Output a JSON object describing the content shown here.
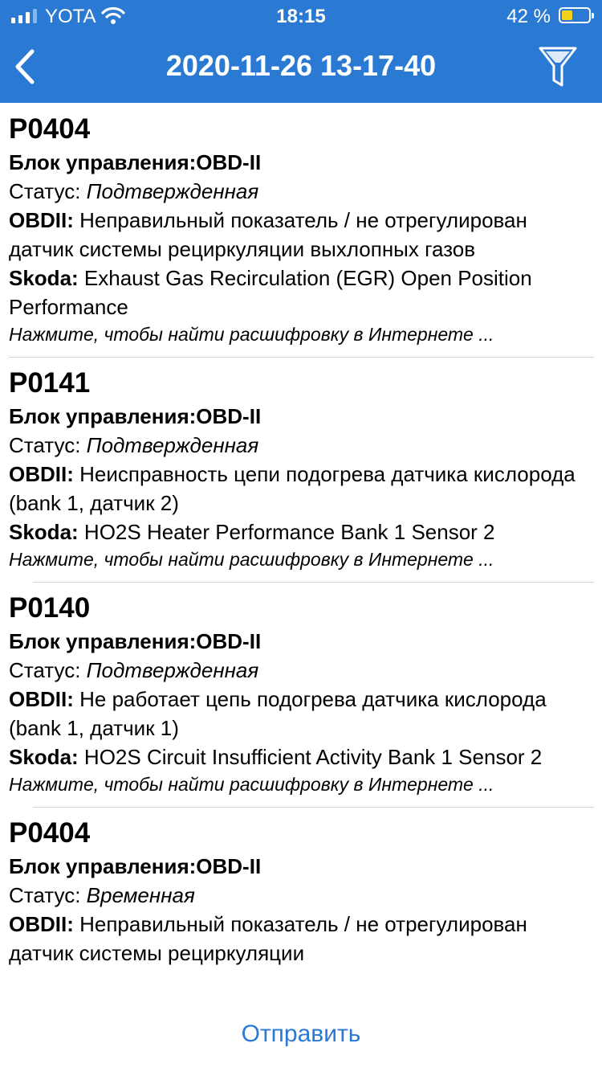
{
  "status_bar": {
    "carrier": "YOTA",
    "time": "18:15",
    "battery_percent": "42 %",
    "battery_level": 0.42,
    "battery_color": "#f6d11b"
  },
  "nav": {
    "title": "2020-11-26 13-17-40",
    "back_icon": "chevron-left-icon",
    "filter_icon": "filter-icon",
    "background_color": "#2a7ad3"
  },
  "records": [
    {
      "code": "P0404",
      "unit_label": "Блок управления:",
      "unit_value": "OBD-II",
      "status_label": "Статус: ",
      "status_value": "Подтвержденная",
      "obd_label": "OBDII: ",
      "obd_text": "Неправильный показатель / не отрегулирован датчик системы рециркуляции выхлопных газов",
      "make_label": "Skoda: ",
      "make_text": "Exhaust Gas Recirculation (EGR) Open Position Performance",
      "hint": "Нажмите, чтобы найти расшифровку в Интернете ..."
    },
    {
      "code": "P0141",
      "unit_label": "Блок управления:",
      "unit_value": "OBD-II",
      "status_label": "Статус: ",
      "status_value": "Подтвержденная",
      "obd_label": "OBDII: ",
      "obd_text": "Неисправность цепи подогрева датчика кислорода (bank 1, датчик 2)",
      "make_label": "Skoda: ",
      "make_text": "HO2S Heater Performance Bank 1 Sensor 2",
      "hint": "Нажмите, чтобы найти расшифровку в Интернете ..."
    },
    {
      "code": "P0140",
      "unit_label": "Блок управления:",
      "unit_value": "OBD-II",
      "status_label": "Статус: ",
      "status_value": "Подтвержденная",
      "obd_label": "OBDII: ",
      "obd_text": "Не работает цепь подогрева датчика кислорода (bank 1, датчик 1)",
      "make_label": "Skoda: ",
      "make_text": "HO2S Circuit Insufficient Activity Bank 1 Sensor 2",
      "hint": "Нажмите, чтобы найти расшифровку в Интернете ..."
    },
    {
      "code": "P0404",
      "unit_label": "Блок управления:",
      "unit_value": "OBD-II",
      "status_label": "Статус: ",
      "status_value": "Временная",
      "obd_label": "OBDII: ",
      "obd_text": "Неправильный показатель / не отрегулирован датчик системы рециркуляции",
      "make_label": "",
      "make_text": "",
      "hint": ""
    }
  ],
  "footer": {
    "send_label": "Отправить",
    "link_color": "#2a7ad3"
  }
}
